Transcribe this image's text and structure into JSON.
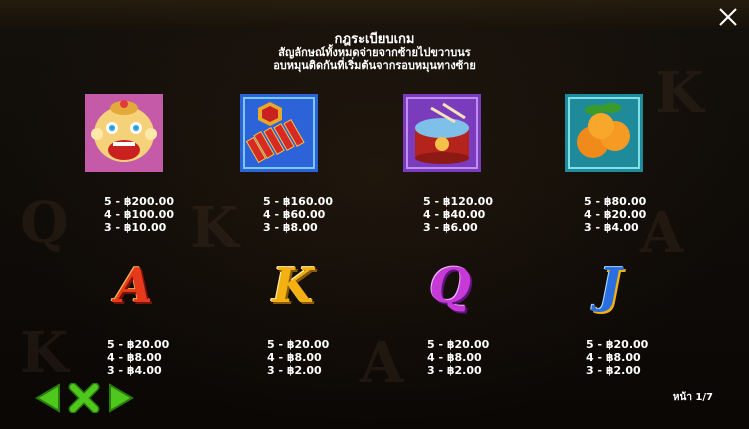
{
  "header": {
    "title": "กฎระเบียบเกม",
    "line1": "สัญลักษณ์ทั้งหมดจ่ายจากซ้ายไปขวาบนร",
    "line2": "อบหมุนติดกันที่เริ่มต้นจากรอบหมุนทางซ้าย"
  },
  "symbols": [
    {
      "icon": "lion-dance-icon",
      "l1": "5 - ฿200.00",
      "l2": "4 - ฿100.00",
      "l3": "3 - ฿10.00"
    },
    {
      "icon": "firecracker-icon",
      "l1": "5 - ฿160.00",
      "l2": "4 - ฿60.00",
      "l3": "3 - ฿8.00"
    },
    {
      "icon": "drum-icon",
      "l1": "5 - ฿120.00",
      "l2": "4 - ฿40.00",
      "l3": "3 - ฿6.00"
    },
    {
      "icon": "oranges-icon",
      "l1": "5 - ฿80.00",
      "l2": "4 - ฿20.00",
      "l3": "3 - ฿4.00"
    }
  ],
  "letters": [
    {
      "letter": "A",
      "l1": "5 - ฿20.00",
      "l2": "4 - ฿8.00",
      "l3": "3 - ฿4.00",
      "color": "#e53a1c"
    },
    {
      "letter": "K",
      "l1": "5 - ฿20.00",
      "l2": "4 - ฿8.00",
      "l3": "3 - ฿2.00",
      "color": "#f3b012"
    },
    {
      "letter": "Q",
      "l1": "5 - ฿20.00",
      "l2": "4 - ฿8.00",
      "l3": "3 - ฿2.00",
      "color": "#c63ad8"
    },
    {
      "letter": "J",
      "l1": "5 - ฿20.00",
      "l2": "4 - ฿8.00",
      "l3": "3 - ฿2.00",
      "color": "#2a6fe0"
    }
  ],
  "footer": {
    "page": "หน้า 1/7"
  },
  "colors": {
    "nav_green": "#4fc81e",
    "close": "#ffffff"
  }
}
